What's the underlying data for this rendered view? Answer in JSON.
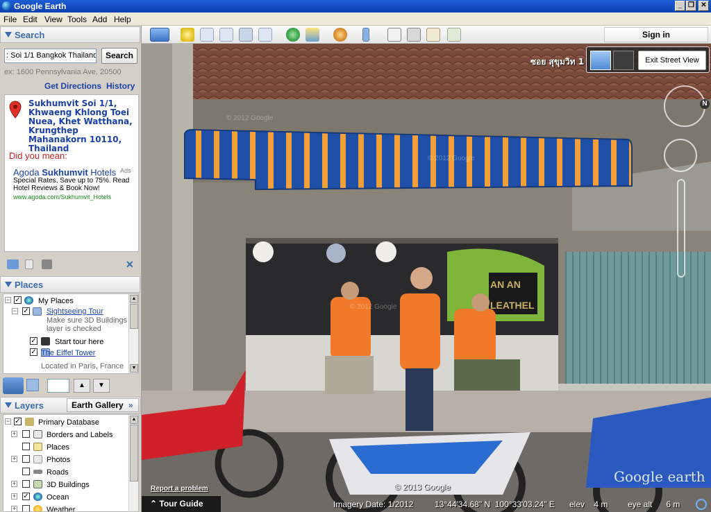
{
  "window": {
    "title": "Google Earth",
    "controls": [
      "_",
      "❐",
      "✕"
    ]
  },
  "menu": [
    "File",
    "Edit",
    "View",
    "Tools",
    "Add",
    "Help"
  ],
  "search": {
    "header": "Search",
    "query": ": Soi 1/1 Bangkok Thailand",
    "button": "Search",
    "hint": "ex: 1600 Pennsylvania Ave, 20500",
    "get_directions": "Get Directions",
    "history": "History",
    "result_address": "Sukhumvit Soi 1/1, Khwaeng Khlong Toei Nuea, Khet Watthana, Krungthep Mahanakorn 10110, Thailand",
    "did_you_mean": "Did you mean:",
    "ad": {
      "title_prefix": "Agoda ",
      "title_bold": "Sukhumvit",
      "title_suffix": " Hotels",
      "tag": "Ads",
      "text": "Special Rates, Save up to 75%. Read Hotel Reviews & Book Now!",
      "url": "www.agoda.com/Sukhumvit_Hotels"
    }
  },
  "places": {
    "header": "Places",
    "items": [
      {
        "label": "My Places"
      },
      {
        "label": "Sightseeing Tour",
        "note": "Make sure 3D Buildings layer is checked"
      },
      {
        "label": "Start tour here"
      },
      {
        "label": "The Eiffel Tower",
        "note": "Located in Paris, France"
      }
    ]
  },
  "layers": {
    "header": "Layers",
    "gallery_button": "Earth Gallery",
    "gallery_arrows": "»",
    "items": [
      {
        "label": "Primary Database",
        "checked": true
      },
      {
        "label": "Borders and Labels",
        "checked": false
      },
      {
        "label": "Places",
        "checked": false
      },
      {
        "label": "Photos",
        "checked": false
      },
      {
        "label": "Roads",
        "checked": false
      },
      {
        "label": "3D Buildings",
        "checked": false
      },
      {
        "label": "Ocean",
        "checked": true
      },
      {
        "label": "Weather",
        "checked": false
      }
    ]
  },
  "toolbar": {
    "sign_in": "Sign in"
  },
  "streetview": {
    "street_label": "ซอย สุขุมวิท 1",
    "exit_button": "Exit Street View",
    "compass_n": "N",
    "report_problem": "Report a problem",
    "tour_guide": "Tour Guide",
    "tour_guide_arrow": "⌃",
    "copyright": "© 2013 Google",
    "watermark1": "© 2012 Google",
    "watermark2": "© 2012 Google",
    "watermark3": "© 2012 Google",
    "logo": "Google earth",
    "shop_sign": "AN AN LEATHER",
    "status": {
      "imagery_date": "Imagery Date: 1/2012",
      "coords": "13°44'34.68\" N  100°33'03.24\" E",
      "elev": "elev    4 m",
      "eye_alt": "eye alt      6 m"
    }
  },
  "colors": {
    "accent_blue": "#3a6cb0",
    "link_blue": "#1a3fa8",
    "awning_blue": "#1f4fa6",
    "awning_orange": "#f2a03a",
    "vest_orange": "#f07a2a"
  }
}
